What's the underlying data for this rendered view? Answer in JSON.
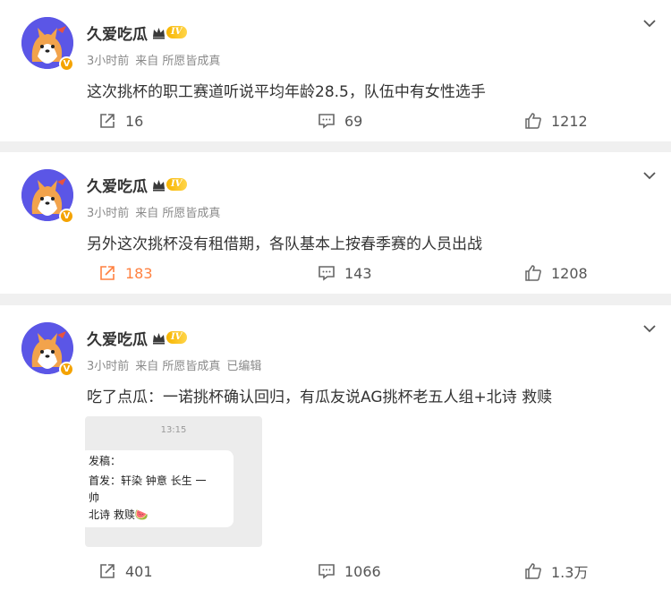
{
  "posts": [
    {
      "username": "久爱吃瓜",
      "level": "IV",
      "time": "3小时前",
      "source": "来自 所愿皆成真",
      "edited": "",
      "text": "这次挑杯的职工赛道听说平均年龄28.5，队伍中有女性选手",
      "reposts": "16",
      "comments": "69",
      "likes": "1212",
      "repost_active": false
    },
    {
      "username": "久爱吃瓜",
      "level": "IV",
      "time": "3小时前",
      "source": "来自 所愿皆成真",
      "edited": "",
      "text": "另外这次挑杯没有租借期，各队基本上按春季赛的人员出战",
      "reposts": "183",
      "comments": "143",
      "likes": "1208",
      "repost_active": true
    },
    {
      "username": "久爱吃瓜",
      "level": "IV",
      "time": "3小时前",
      "source": "来自 所愿皆成真",
      "edited": "已编辑",
      "text": "吃了点瓜：一诺挑杯确认回归，有瓜友说AG挑杯老五人组+北诗 救赎",
      "reposts": "401",
      "comments": "1066",
      "likes": "1.3万",
      "repost_active": false,
      "image": {
        "time": "13:15",
        "line1": "发稿：",
        "line2": "首发：轩染 钟意 长生 一",
        "line3": "帅",
        "line4": "北诗 救赎🍉"
      }
    }
  ],
  "colors": {
    "accent": "#ff8140",
    "avatar_bg": "#5b56e6",
    "badge": "#f4a300",
    "meta": "#8a8a8a"
  },
  "icons": {
    "repost": "repost-icon",
    "comment": "comment-icon",
    "like": "like-icon",
    "menu": "chevron-down-icon",
    "verified": "verified-badge-icon",
    "crown": "crown-icon"
  }
}
